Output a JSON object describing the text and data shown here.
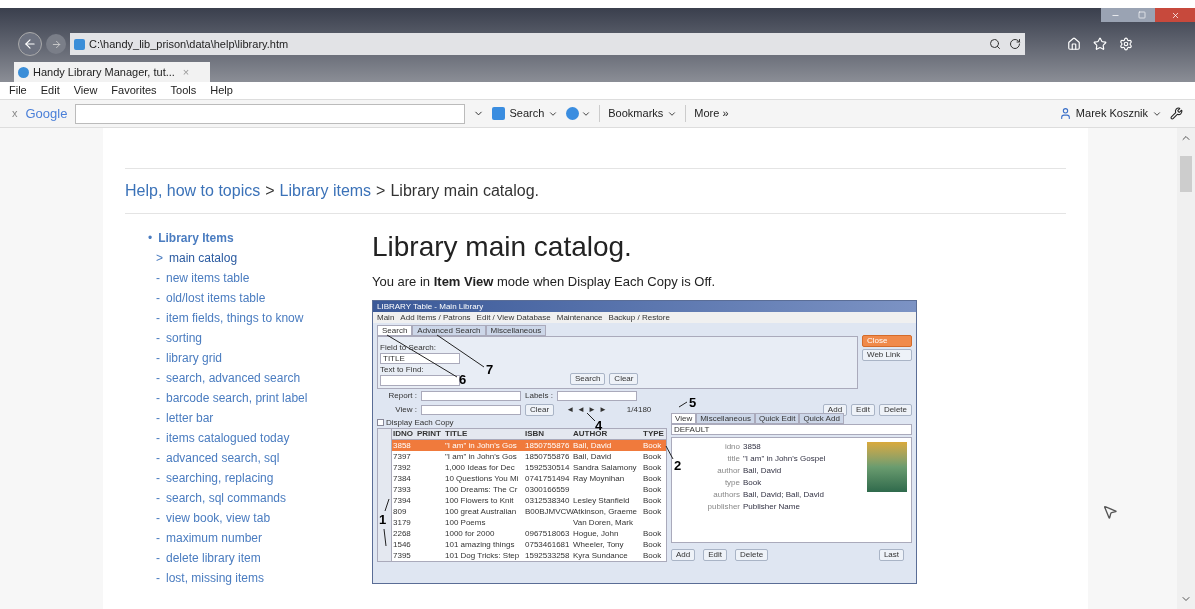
{
  "browser": {
    "address": "C:\\handy_lib_prison\\data\\help\\library.htm",
    "tab_title": "Handy Library Manager, tut...",
    "tab_close": "×",
    "menu": [
      "File",
      "Edit",
      "View",
      "Favorites",
      "Tools",
      "Help"
    ],
    "toolbar": {
      "close": "x",
      "logo": "Google",
      "search_button": "Search",
      "bookmarks": "Bookmarks",
      "more": "More »",
      "user": "Marek Kosznik"
    }
  },
  "page": {
    "breadcrumb": [
      {
        "label": "Help, how to topics",
        "kind": "link"
      },
      {
        "label": ">",
        "kind": "sep"
      },
      {
        "label": "Library items",
        "kind": "link"
      },
      {
        "label": ">",
        "kind": "sep"
      },
      {
        "label": "Library main catalog.",
        "kind": "text"
      }
    ],
    "nav": {
      "bullet": "•",
      "header": "Library Items",
      "items": [
        {
          "marker": ">",
          "label": "main catalog",
          "selected": true
        },
        {
          "marker": "-",
          "label": "new items table",
          "selected": false
        },
        {
          "marker": "-",
          "label": "old/lost items table",
          "selected": false
        },
        {
          "marker": "-",
          "label": "item fields, things to know",
          "selected": false
        },
        {
          "marker": "-",
          "label": "sorting",
          "selected": false
        },
        {
          "marker": "-",
          "label": "library grid",
          "selected": false
        },
        {
          "marker": "-",
          "label": "search, advanced search",
          "selected": false
        },
        {
          "marker": "-",
          "label": "barcode search, print label",
          "selected": false
        },
        {
          "marker": "-",
          "label": "letter bar",
          "selected": false
        },
        {
          "marker": "-",
          "label": "items catalogued today",
          "selected": false
        },
        {
          "marker": "-",
          "label": "advanced search, sql",
          "selected": false
        },
        {
          "marker": "-",
          "label": "searching, replacing",
          "selected": false
        },
        {
          "marker": "-",
          "label": "search, sql commands",
          "selected": false
        },
        {
          "marker": "-",
          "label": "view book, view tab",
          "selected": false
        },
        {
          "marker": "-",
          "label": "maximum number",
          "selected": false
        },
        {
          "marker": "-",
          "label": "delete library item",
          "selected": false
        },
        {
          "marker": "-",
          "label": "lost, missing items",
          "selected": false
        }
      ]
    },
    "heading": "Library main catalog.",
    "intro": "You are in **Item View** mode when Display Each Copy is Off.",
    "screenshot": {
      "title": "LIBRARY Table - Main Library",
      "menu": [
        "Main",
        "Add Items / Patrons",
        "Edit / View Database",
        "Maintenance",
        "Backup / Restore"
      ],
      "search_tabs": [
        {
          "label": "Search",
          "selected": true
        },
        {
          "label": "Advanced Search",
          "selected": false
        },
        {
          "label": "Miscellaneous",
          "selected": false
        }
      ],
      "field_label": "Field to Search:",
      "field_value": "TITLE",
      "text_label": "Text to Find:",
      "search_button": "Search",
      "clear_button": "Clear",
      "close_button": "Close",
      "weblink_button": "Web Link",
      "report_label": "Report :",
      "labels_label": "Labels :",
      "view_label": "View :",
      "view_clear": "Clear",
      "nav_arrows": [
        "◄",
        "◄",
        "►",
        "►"
      ],
      "record_count": "1/4180",
      "action_buttons": [
        "Add",
        "Edit",
        "Delete"
      ],
      "display_each_copy": {
        "label": "Display Each Copy",
        "checked": false
      },
      "columns": [
        "IDNO",
        "PRINT",
        "TITLE",
        "ISBN",
        "AUTHOR",
        "TYPE"
      ],
      "rows": [
        {
          "cells": [
            "3858",
            "",
            "\"I am\" in John's Gos",
            "1850755876",
            "Ball, David",
            "Book"
          ],
          "selected": true
        },
        {
          "cells": [
            "7397",
            "",
            "\"I am\" in John's Gos",
            "1850755876",
            "Ball, David",
            "Book"
          ],
          "selected": false
        },
        {
          "cells": [
            "7392",
            "",
            "1,000 Ideas for Dec",
            "1592530514",
            "Sandra Salamony",
            "Book"
          ],
          "selected": false
        },
        {
          "cells": [
            "7384",
            "",
            "10 Questions You Mi",
            "0741751494",
            "Ray Moynihan",
            "Book"
          ],
          "selected": false
        },
        {
          "cells": [
            "7393",
            "",
            "100 Dreams: The Cr",
            "0300166559",
            "",
            "Book"
          ],
          "selected": false
        },
        {
          "cells": [
            "7394",
            "",
            "100 Flowers to Knit",
            "0312538340",
            "Lesley Stanfield",
            "Book"
          ],
          "selected": false
        },
        {
          "cells": [
            "809",
            "",
            "100 great Australian",
            "B00BJMVCW",
            "Atkinson, Graeme",
            "Book"
          ],
          "selected": false
        },
        {
          "cells": [
            "3179",
            "",
            "100 Poems",
            "",
            "Van Doren, Mark",
            ""
          ],
          "selected": false
        },
        {
          "cells": [
            "2268",
            "",
            "1000 for 2000",
            "0967518063",
            "Hogue, John",
            "Book"
          ],
          "selected": false
        },
        {
          "cells": [
            "1546",
            "",
            "101 amazing things",
            "0753461681",
            "Wheeler, Tony",
            "Book"
          ],
          "selected": false
        },
        {
          "cells": [
            "7395",
            "",
            "101 Dog Tricks: Step",
            "1592533258",
            "Kyra Sundance",
            "Book"
          ],
          "selected": false
        }
      ],
      "view_tabs": [
        {
          "label": "View",
          "selected": true
        },
        {
          "label": "Miscellaneous",
          "selected": false
        },
        {
          "label": "Quick Edit",
          "selected": false
        },
        {
          "label": "Quick Add",
          "selected": false
        }
      ],
      "view_select": "DEFAULT",
      "details": [
        {
          "label": "idno",
          "value": "3858"
        },
        {
          "label": "title",
          "value": "\"I am\" in John's Gospel"
        },
        {
          "label": "author",
          "value": "Ball, David"
        },
        {
          "label": "type",
          "value": "Book"
        },
        {
          "label": "authors",
          "value": "Ball, David; Ball, David"
        },
        {
          "label": "publisher",
          "value": "Publisher Name"
        }
      ],
      "bottom_buttons": [
        "Add",
        "Edit",
        "Delete",
        "Last"
      ],
      "callouts": [
        "1",
        "2",
        "4",
        "5",
        "6",
        "7"
      ]
    }
  }
}
